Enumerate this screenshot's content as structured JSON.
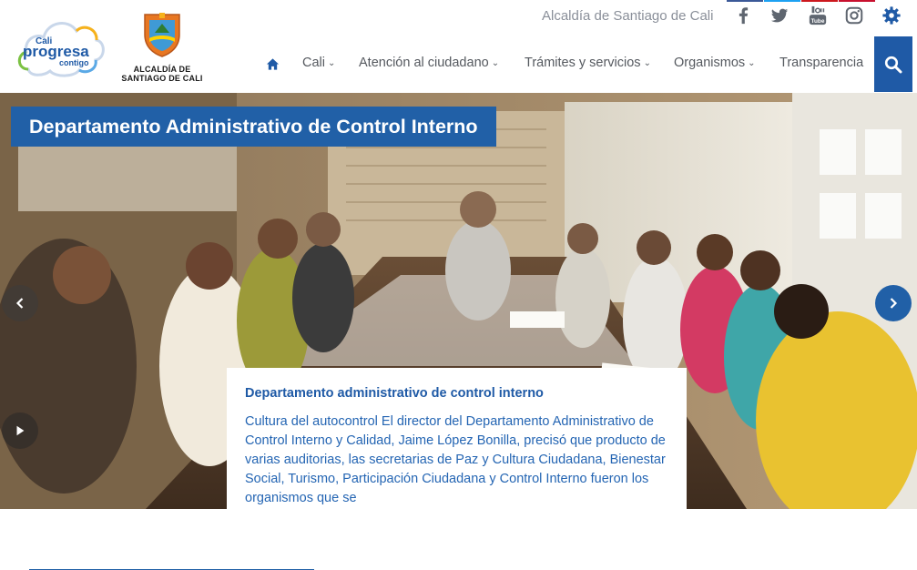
{
  "header": {
    "logo_cloud_text": [
      "Cali",
      "progresa",
      "contigo"
    ],
    "logo_shield_caption_line1": "ALCALDÍA DE",
    "logo_shield_caption_line2": "SANTIAGO DE CALI",
    "site_name": "Alcaldía de Santiago de Cali",
    "social_icons": [
      "facebook-icon",
      "twitter-icon",
      "youtube-icon",
      "instagram-icon",
      "gear-icon"
    ],
    "social_bar_colors": [
      "#3b5998",
      "#1da1f2",
      "#cc181e",
      "#c8102e"
    ],
    "brand_color": "#1f5aa6"
  },
  "nav": {
    "home_icon": "home-icon",
    "items": [
      {
        "label": "Cali",
        "dropdown": true
      },
      {
        "label": "Atención al ciudadano",
        "dropdown": true
      },
      {
        "label": "Trámites y servicios",
        "dropdown": true
      },
      {
        "label": "Organismos",
        "dropdown": true
      },
      {
        "label": "Transparencia",
        "dropdown": false
      }
    ],
    "search_icon": "search-icon"
  },
  "hero": {
    "title": "Departamento Administrativo de Control Interno",
    "caption_title": "Departamento administrativo de control interno",
    "caption_text": "Cultura del autocontrol El director del Departamento Administrativo de Control Interno y Calidad, Jaime López Bonilla, precisó que producto de varias auditorias, las secretarias de Paz y Cultura Ciudadana, Bienestar Social, Turismo, Participación Ciudadana y Control Interno fueron los organismos que se"
  }
}
